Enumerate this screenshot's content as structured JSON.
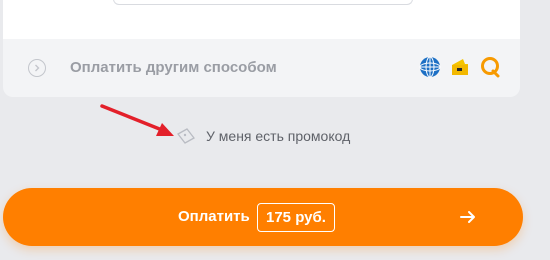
{
  "payment": {
    "other_method_label": "Оплатить другим способом",
    "icons": [
      "webmoney-icon",
      "yandex-wallet-icon",
      "qiwi-icon"
    ]
  },
  "promo": {
    "label": "У меня есть промокод"
  },
  "pay_button": {
    "label": "Оплатить",
    "price": "175 руб."
  },
  "colors": {
    "accent": "#ff7f00",
    "annotation_arrow": "#e3202a",
    "webmoney": "#1c6fc4",
    "yandex": "#f5c400",
    "qiwi": "#f79a00"
  }
}
